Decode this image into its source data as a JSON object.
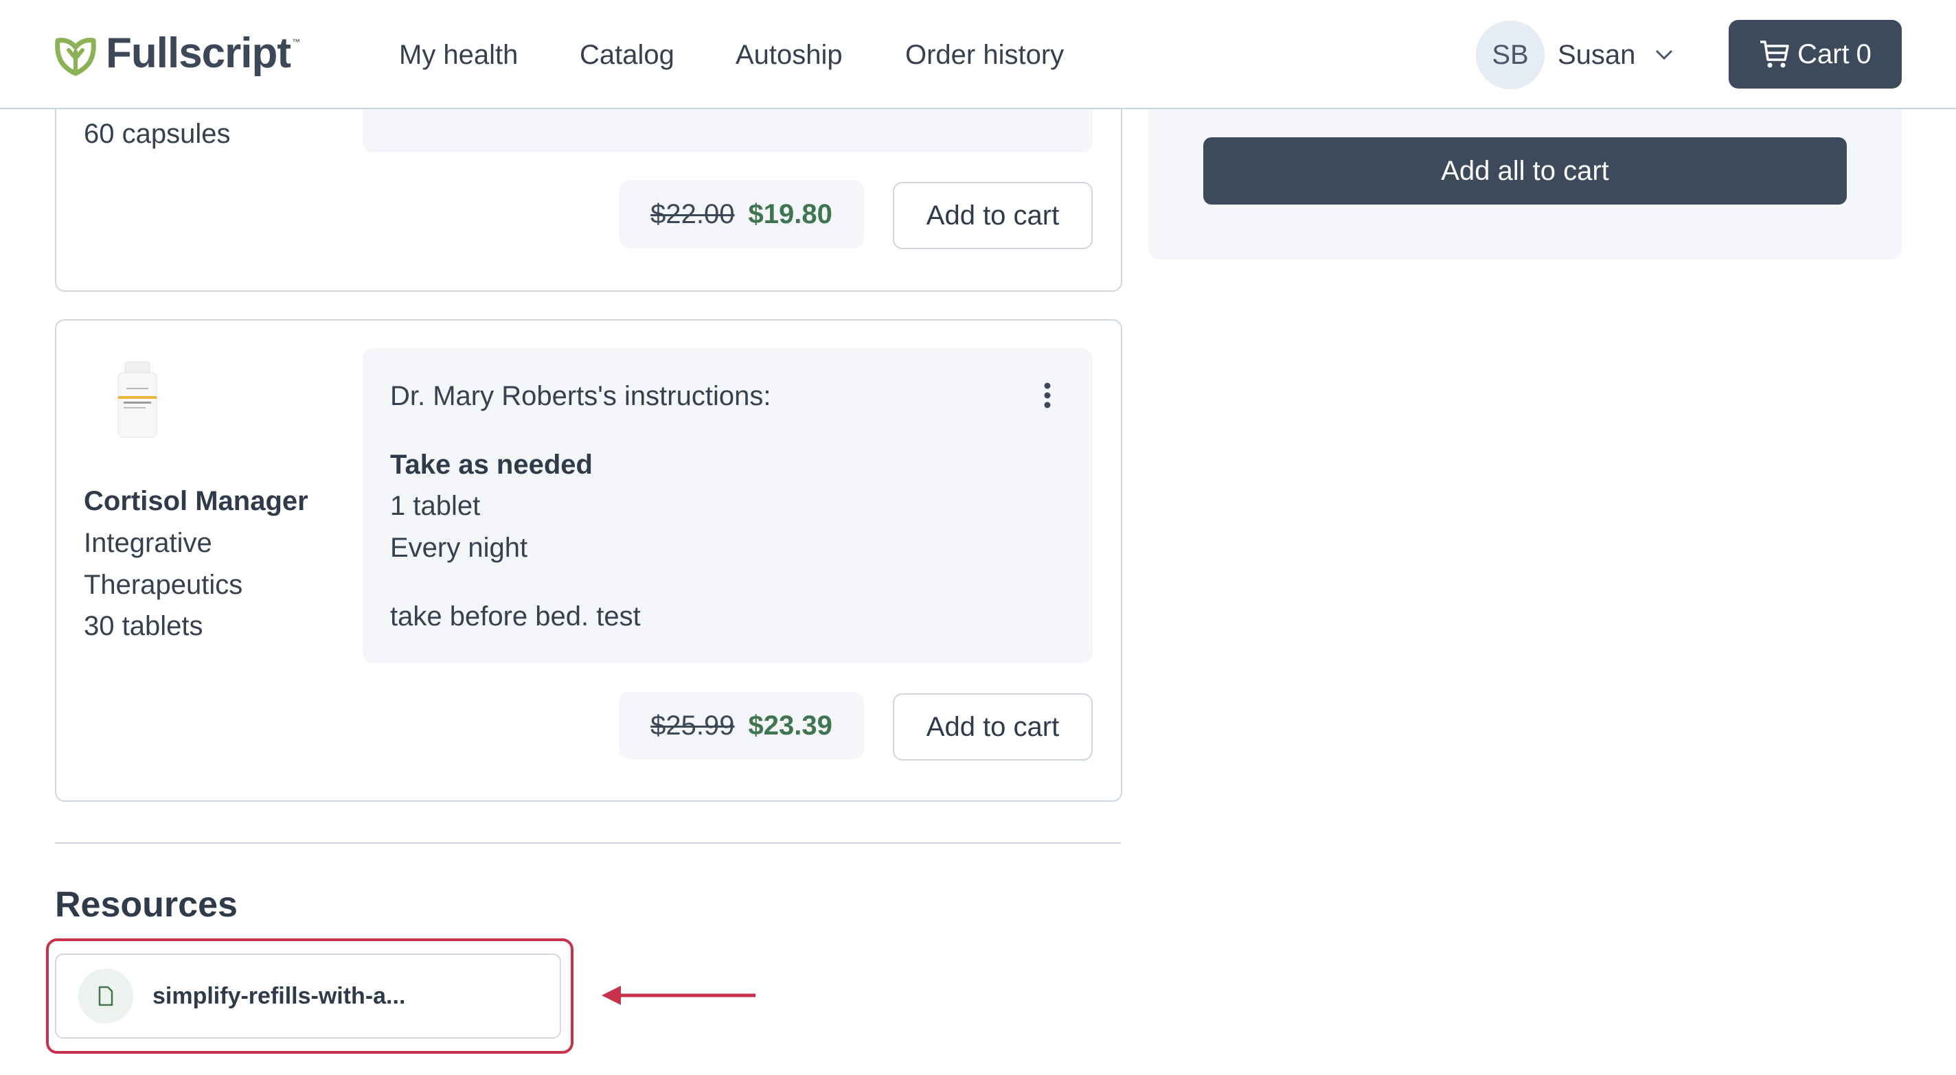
{
  "header": {
    "logo_text": "Fullscript",
    "logo_tm": "™",
    "nav": [
      {
        "label": "My health"
      },
      {
        "label": "Catalog"
      },
      {
        "label": "Autoship"
      },
      {
        "label": "Order history"
      }
    ],
    "user": {
      "initials": "SB",
      "name": "Susan"
    },
    "cart": {
      "label": "Cart",
      "count": "0"
    }
  },
  "products": [
    {
      "size": "60 capsules",
      "price_original": "$22.00",
      "price_discounted": "$19.80",
      "add_label": "Add to cart"
    },
    {
      "name": "Cortisol Manager",
      "brand_line1": "Integrative",
      "brand_line2": "Therapeutics",
      "size": "30 tablets",
      "instructions": {
        "heading": "Dr. Mary Roberts's instructions:",
        "frequency": "Take as needed",
        "dosage": "1 tablet",
        "timing": "Every night",
        "note": "take before bed. test"
      },
      "price_original": "$25.99",
      "price_discounted": "$23.39",
      "add_label": "Add to cart"
    }
  ],
  "sidebar": {
    "add_all_label": "Add all to cart"
  },
  "resources": {
    "title": "Resources",
    "items": [
      {
        "name": "simplify-refills-with-a..."
      }
    ]
  },
  "colors": {
    "brand_green": "#8cb258",
    "primary_dark": "#3c4a5c",
    "price_green": "#3f7550",
    "highlight_red": "#c8324a"
  }
}
